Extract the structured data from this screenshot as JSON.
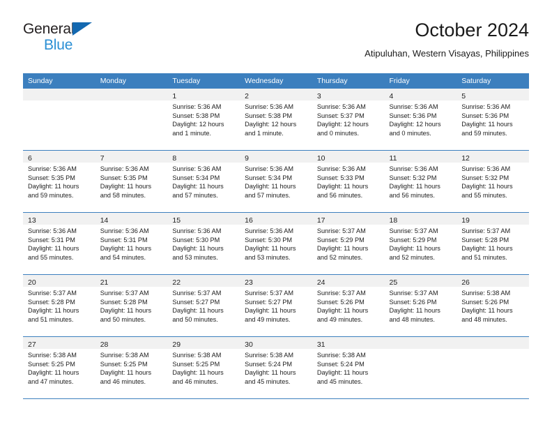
{
  "brand": {
    "name_part1": "General",
    "name_part2": "Blue",
    "logo_icon": "triangle-logo-icon"
  },
  "header": {
    "title": "October 2024",
    "subtitle": "Atipuluhan, Western Visayas, Philippines"
  },
  "theme": {
    "header_blue": "#3c7fbe",
    "brand_dark_blue": "#1368b0",
    "brand_light_blue": "#2b8fd4",
    "date_bar_gray": "#f1f1f1",
    "text": "#1c1c1c"
  },
  "calendar": {
    "weekday_headers": [
      "Sunday",
      "Monday",
      "Tuesday",
      "Wednesday",
      "Thursday",
      "Friday",
      "Saturday"
    ],
    "weeks": [
      [
        {
          "day": "",
          "lines": []
        },
        {
          "day": "",
          "lines": []
        },
        {
          "day": "1",
          "lines": [
            "Sunrise: 5:36 AM",
            "Sunset: 5:38 PM",
            "Daylight: 12 hours",
            "and 1 minute."
          ]
        },
        {
          "day": "2",
          "lines": [
            "Sunrise: 5:36 AM",
            "Sunset: 5:38 PM",
            "Daylight: 12 hours",
            "and 1 minute."
          ]
        },
        {
          "day": "3",
          "lines": [
            "Sunrise: 5:36 AM",
            "Sunset: 5:37 PM",
            "Daylight: 12 hours",
            "and 0 minutes."
          ]
        },
        {
          "day": "4",
          "lines": [
            "Sunrise: 5:36 AM",
            "Sunset: 5:36 PM",
            "Daylight: 12 hours",
            "and 0 minutes."
          ]
        },
        {
          "day": "5",
          "lines": [
            "Sunrise: 5:36 AM",
            "Sunset: 5:36 PM",
            "Daylight: 11 hours",
            "and 59 minutes."
          ]
        }
      ],
      [
        {
          "day": "6",
          "lines": [
            "Sunrise: 5:36 AM",
            "Sunset: 5:35 PM",
            "Daylight: 11 hours",
            "and 59 minutes."
          ]
        },
        {
          "day": "7",
          "lines": [
            "Sunrise: 5:36 AM",
            "Sunset: 5:35 PM",
            "Daylight: 11 hours",
            "and 58 minutes."
          ]
        },
        {
          "day": "8",
          "lines": [
            "Sunrise: 5:36 AM",
            "Sunset: 5:34 PM",
            "Daylight: 11 hours",
            "and 57 minutes."
          ]
        },
        {
          "day": "9",
          "lines": [
            "Sunrise: 5:36 AM",
            "Sunset: 5:34 PM",
            "Daylight: 11 hours",
            "and 57 minutes."
          ]
        },
        {
          "day": "10",
          "lines": [
            "Sunrise: 5:36 AM",
            "Sunset: 5:33 PM",
            "Daylight: 11 hours",
            "and 56 minutes."
          ]
        },
        {
          "day": "11",
          "lines": [
            "Sunrise: 5:36 AM",
            "Sunset: 5:32 PM",
            "Daylight: 11 hours",
            "and 56 minutes."
          ]
        },
        {
          "day": "12",
          "lines": [
            "Sunrise: 5:36 AM",
            "Sunset: 5:32 PM",
            "Daylight: 11 hours",
            "and 55 minutes."
          ]
        }
      ],
      [
        {
          "day": "13",
          "lines": [
            "Sunrise: 5:36 AM",
            "Sunset: 5:31 PM",
            "Daylight: 11 hours",
            "and 55 minutes."
          ]
        },
        {
          "day": "14",
          "lines": [
            "Sunrise: 5:36 AM",
            "Sunset: 5:31 PM",
            "Daylight: 11 hours",
            "and 54 minutes."
          ]
        },
        {
          "day": "15",
          "lines": [
            "Sunrise: 5:36 AM",
            "Sunset: 5:30 PM",
            "Daylight: 11 hours",
            "and 53 minutes."
          ]
        },
        {
          "day": "16",
          "lines": [
            "Sunrise: 5:36 AM",
            "Sunset: 5:30 PM",
            "Daylight: 11 hours",
            "and 53 minutes."
          ]
        },
        {
          "day": "17",
          "lines": [
            "Sunrise: 5:37 AM",
            "Sunset: 5:29 PM",
            "Daylight: 11 hours",
            "and 52 minutes."
          ]
        },
        {
          "day": "18",
          "lines": [
            "Sunrise: 5:37 AM",
            "Sunset: 5:29 PM",
            "Daylight: 11 hours",
            "and 52 minutes."
          ]
        },
        {
          "day": "19",
          "lines": [
            "Sunrise: 5:37 AM",
            "Sunset: 5:28 PM",
            "Daylight: 11 hours",
            "and 51 minutes."
          ]
        }
      ],
      [
        {
          "day": "20",
          "lines": [
            "Sunrise: 5:37 AM",
            "Sunset: 5:28 PM",
            "Daylight: 11 hours",
            "and 51 minutes."
          ]
        },
        {
          "day": "21",
          "lines": [
            "Sunrise: 5:37 AM",
            "Sunset: 5:28 PM",
            "Daylight: 11 hours",
            "and 50 minutes."
          ]
        },
        {
          "day": "22",
          "lines": [
            "Sunrise: 5:37 AM",
            "Sunset: 5:27 PM",
            "Daylight: 11 hours",
            "and 50 minutes."
          ]
        },
        {
          "day": "23",
          "lines": [
            "Sunrise: 5:37 AM",
            "Sunset: 5:27 PM",
            "Daylight: 11 hours",
            "and 49 minutes."
          ]
        },
        {
          "day": "24",
          "lines": [
            "Sunrise: 5:37 AM",
            "Sunset: 5:26 PM",
            "Daylight: 11 hours",
            "and 49 minutes."
          ]
        },
        {
          "day": "25",
          "lines": [
            "Sunrise: 5:37 AM",
            "Sunset: 5:26 PM",
            "Daylight: 11 hours",
            "and 48 minutes."
          ]
        },
        {
          "day": "26",
          "lines": [
            "Sunrise: 5:38 AM",
            "Sunset: 5:26 PM",
            "Daylight: 11 hours",
            "and 48 minutes."
          ]
        }
      ],
      [
        {
          "day": "27",
          "lines": [
            "Sunrise: 5:38 AM",
            "Sunset: 5:25 PM",
            "Daylight: 11 hours",
            "and 47 minutes."
          ]
        },
        {
          "day": "28",
          "lines": [
            "Sunrise: 5:38 AM",
            "Sunset: 5:25 PM",
            "Daylight: 11 hours",
            "and 46 minutes."
          ]
        },
        {
          "day": "29",
          "lines": [
            "Sunrise: 5:38 AM",
            "Sunset: 5:25 PM",
            "Daylight: 11 hours",
            "and 46 minutes."
          ]
        },
        {
          "day": "30",
          "lines": [
            "Sunrise: 5:38 AM",
            "Sunset: 5:24 PM",
            "Daylight: 11 hours",
            "and 45 minutes."
          ]
        },
        {
          "day": "31",
          "lines": [
            "Sunrise: 5:38 AM",
            "Sunset: 5:24 PM",
            "Daylight: 11 hours",
            "and 45 minutes."
          ]
        },
        {
          "day": "",
          "lines": []
        },
        {
          "day": "",
          "lines": []
        }
      ]
    ]
  }
}
